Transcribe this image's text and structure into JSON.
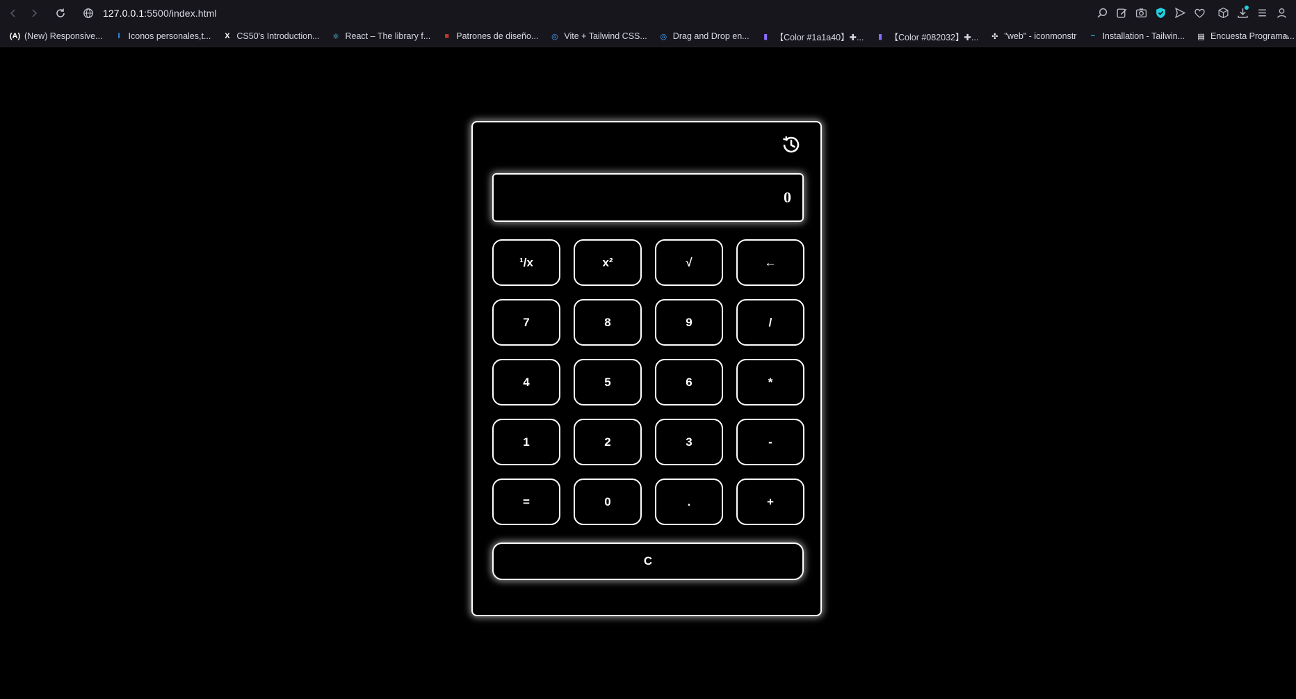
{
  "browser": {
    "url_host": "127.0.0.1",
    "url_rest": ":5500/index.html",
    "bookmarks": [
      {
        "label": "(New) Responsive...",
        "icon": "(A)",
        "color": "#ffffff"
      },
      {
        "label": "Iconos personales,t...",
        "icon": "I",
        "color": "#3aa0ff"
      },
      {
        "label": "CS50's Introduction...",
        "icon": "X",
        "color": "#ffffff"
      },
      {
        "label": "React – The library f...",
        "icon": "⚛",
        "color": "#61dafb"
      },
      {
        "label": "Patrones de diseño...",
        "icon": "■",
        "color": "#c0392b"
      },
      {
        "label": "Vite + Tailwind CSS...",
        "icon": "◎",
        "color": "#4aa3ff"
      },
      {
        "label": "Drag and Drop en...",
        "icon": "◎",
        "color": "#4aa3ff"
      },
      {
        "label": "【Color #1a1a40】✚...",
        "icon": "▮",
        "color": "#8a6cff"
      },
      {
        "label": "【Color #082032】✚...",
        "icon": "▮",
        "color": "#8a6cff"
      },
      {
        "label": "\"web\" - iconmonstr",
        "icon": "✣",
        "color": "#ffffff"
      },
      {
        "label": "Installation - Tailwin...",
        "icon": "~",
        "color": "#38bdf8"
      },
      {
        "label": "Encuesta Programa...",
        "icon": "▤",
        "color": "#ffffff"
      }
    ],
    "more": "»"
  },
  "calculator": {
    "display": "0",
    "keys": [
      "¹/x",
      "x²",
      "√",
      "←",
      "7",
      "8",
      "9",
      "/",
      "4",
      "5",
      "6",
      "*",
      "1",
      "2",
      "3",
      "-",
      "=",
      "0",
      ".",
      "+"
    ],
    "key_names": [
      "reciprocal",
      "square",
      "sqrt",
      "backspace",
      "7",
      "8",
      "9",
      "divide",
      "4",
      "5",
      "6",
      "multiply",
      "1",
      "2",
      "3",
      "subtract",
      "equals",
      "0",
      "decimal",
      "add"
    ],
    "clear_label": "C"
  },
  "colors": {
    "background": "#000000",
    "border": "#ffffff",
    "chrome": "#16161c",
    "accent": "#1fd2e0"
  }
}
